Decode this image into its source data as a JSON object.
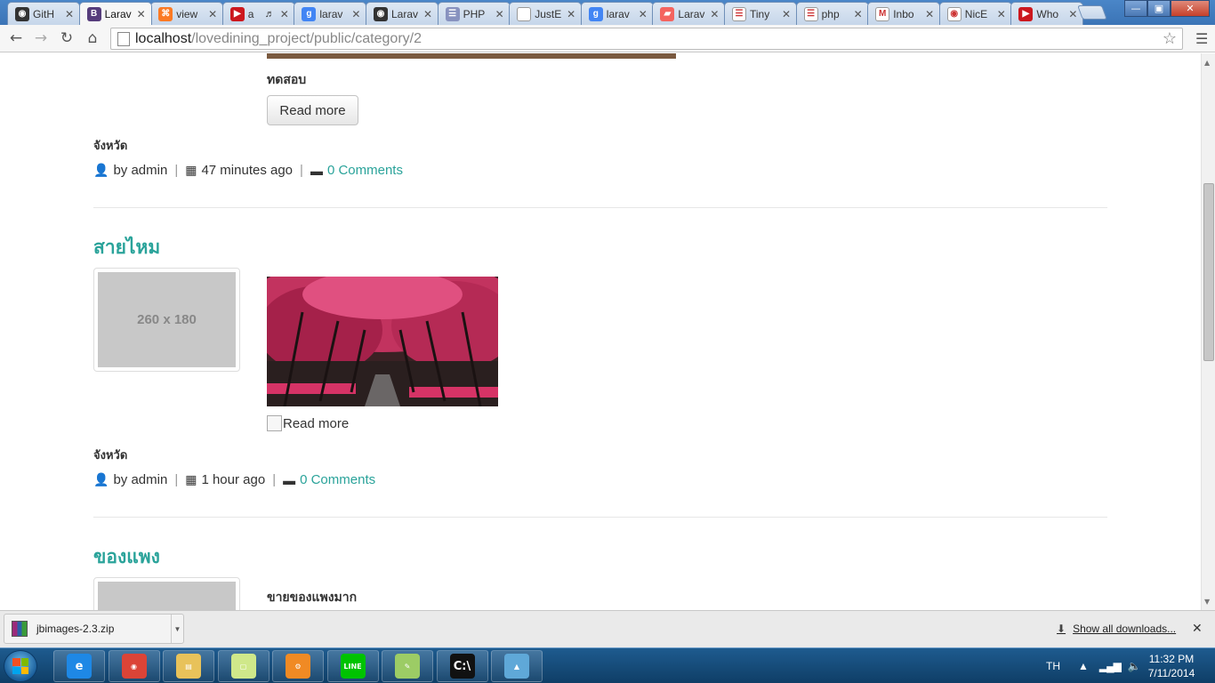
{
  "browser": {
    "tabs": [
      {
        "label": "GitH",
        "icon": "github-icon",
        "color": "#333333"
      },
      {
        "label": "Larav",
        "icon": "bootstrap-icon",
        "color": "#563d7c",
        "active": true
      },
      {
        "label": "view",
        "icon": "xampp-icon",
        "color": "#fb7a24"
      },
      {
        "label": "a",
        "icon": "youtube-icon",
        "color": "#cc181e",
        "audio": true
      },
      {
        "label": "larav",
        "icon": "google-icon",
        "color": "#4285f4"
      },
      {
        "label": "Larav",
        "icon": "github-icon",
        "color": "#333333"
      },
      {
        "label": "PHP",
        "icon": "php-icon",
        "color": "#8892bf"
      },
      {
        "label": "JustE",
        "icon": "page-icon",
        "color": "#ffffff"
      },
      {
        "label": "larav",
        "icon": "google-icon",
        "color": "#4285f4"
      },
      {
        "label": "Larav",
        "icon": "laravel-icon",
        "color": "#f4645f"
      },
      {
        "label": "Tiny",
        "icon": "tinymce-icon",
        "color": "#ffffff"
      },
      {
        "label": "php",
        "icon": "php-icon",
        "color": "#ffffff"
      },
      {
        "label": "Inbo",
        "icon": "gmail-icon",
        "color": "#ffffff"
      },
      {
        "label": "NicE",
        "icon": "nicedit-icon",
        "color": "#ffffff"
      },
      {
        "label": "Who",
        "icon": "youtube-icon",
        "color": "#cc181e"
      }
    ],
    "address": {
      "host": "localhost",
      "path": "/lovedining_project/public/category/2"
    }
  },
  "page": {
    "post1": {
      "description": "ทดสอบ",
      "read_more": "Read more",
      "province": "จังหวัด",
      "author": "by admin",
      "time": "47 minutes ago",
      "comments": "0 Comments"
    },
    "post2": {
      "title": "สายไหม",
      "thumb_placeholder": "260 x 180",
      "read_more": "Read more",
      "province": "จังหวัด",
      "author": "by admin",
      "time": "1 hour ago",
      "comments": "0 Comments"
    },
    "post3": {
      "title": "ของแพง",
      "description": "ขายของแพงมาก"
    }
  },
  "downloads": {
    "file": "jbimages-2.3.zip",
    "show_all": "Show all downloads..."
  },
  "taskbar": {
    "apps": [
      "internet-explorer-icon",
      "chrome-icon",
      "explorer-icon",
      "sticky-notes-icon",
      "settings-icon",
      "line-icon",
      "notepad-icon",
      "cmd-icon",
      "image-viewer-icon"
    ],
    "language": "TH",
    "time": "11:32 PM",
    "date": "7/11/2014"
  }
}
